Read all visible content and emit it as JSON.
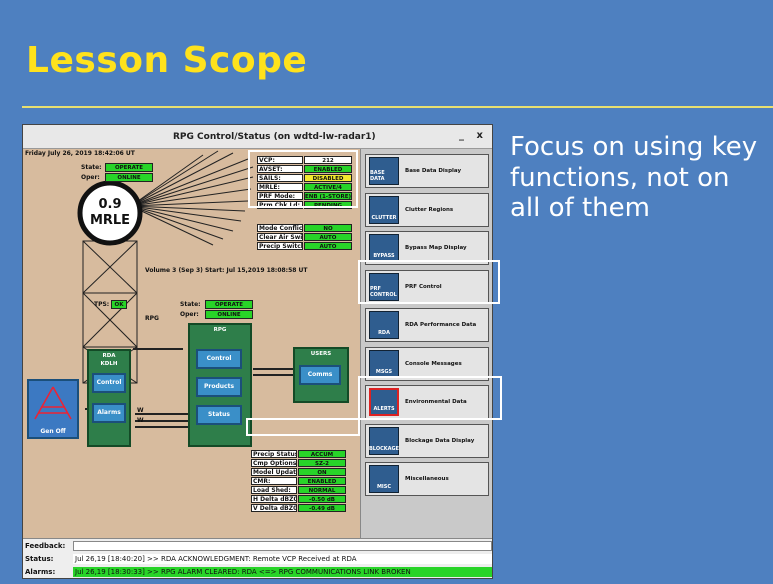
{
  "slide": {
    "title": "Lesson Scope",
    "bullet": "Focus on using key functions, not on all of them"
  },
  "window": {
    "title": "RPG Control/Status (on wdtd-lw-radar1)",
    "minimize": "_",
    "close": "x"
  },
  "main": {
    "date": "Friday July 26, 2019  18:42:06 UT",
    "rda": {
      "state_label": "State:",
      "state_value": "OPERATE",
      "oper_label": "Oper:",
      "oper_value": "ONLINE",
      "radome_line1": "0.9",
      "radome_line2": "MRLE",
      "tps_label": "TPS:",
      "tps_value": "OK",
      "unit_title": "RDA",
      "unit_sub": "KDLH",
      "control": "Control",
      "alarms": "Alarms"
    },
    "status_table": [
      {
        "label": "VCP:",
        "value": "212",
        "style": "white"
      },
      {
        "label": "AVSET:",
        "value": "ENABLED",
        "style": "green"
      },
      {
        "label": "SAILS:",
        "value": "DISABLED",
        "style": "yellow"
      },
      {
        "label": "MRLE:",
        "value": "ACTIVE/4",
        "style": "green"
      },
      {
        "label": "PRF Mode:",
        "value": "ENB (1-STORE)",
        "style": "green"
      },
      {
        "label": "Prm Chk Ld:",
        "value": "PENDING",
        "style": "green"
      }
    ],
    "mode_table": [
      {
        "label": "Mode Conflict:",
        "value": "NO"
      },
      {
        "label": "Clear Air Switch:",
        "value": "AUTO"
      },
      {
        "label": "Precip Switch:",
        "value": "AUTO"
      }
    ],
    "volume": "Volume 3 (Sep 3) Start: Jul 15,2019  18:08:58 UT",
    "rpg": {
      "state_label": "State:",
      "state_value": "OPERATE",
      "oper_label": "Oper:",
      "oper_value": "ONLINE",
      "link_label": "RPG",
      "unit_title": "RPG",
      "control": "Control",
      "products": "Products",
      "status": "Status"
    },
    "users": {
      "unit_title": "USERS",
      "comms": "Comms"
    },
    "gen": {
      "label": "Gen Off"
    },
    "link_labels": [
      "W",
      "W"
    ],
    "lower_table": [
      {
        "label": "Precip Status:",
        "value": "ACCUM"
      },
      {
        "label": "Cmp Options:",
        "value": "SZ-2"
      },
      {
        "label": "Model Update:",
        "value": "ON"
      },
      {
        "label": "CMR:",
        "value": "ENABLED"
      },
      {
        "label": "Load Shed:",
        "value": "NORMAL"
      },
      {
        "label": "H Delta dBZ0:",
        "value": "-0.50 dB"
      },
      {
        "label": "V Delta dBZ0:",
        "value": "-0.49 dB"
      }
    ]
  },
  "sidebar": {
    "items": [
      {
        "label": "Base Data Display",
        "icon": "base-data-icon",
        "icon_text": "BASE DATA"
      },
      {
        "label": "Clutter Regions",
        "icon": "clutter-icon",
        "icon_text": "CLUTTER"
      },
      {
        "label": "Bypass Map Display",
        "icon": "bypass-map-icon",
        "icon_text": "BYPASS"
      },
      {
        "label": "PRF Control",
        "icon": "prf-icon",
        "icon_text": "PRF CONTROL"
      },
      {
        "label": "RDA Performance Data",
        "icon": "rda-perf-icon",
        "icon_text": "RDA"
      },
      {
        "label": "Console Messages",
        "icon": "console-icon",
        "icon_text": "MSGS"
      },
      {
        "label": "Environmental Data",
        "icon": "environmental-icon",
        "icon_text": "ALERTS"
      },
      {
        "label": "Blockage Data Display",
        "icon": "blockage-icon",
        "icon_text": "BLOCKAGE"
      },
      {
        "label": "Miscellaneous",
        "icon": "misc-icon",
        "icon_text": "MISC"
      }
    ]
  },
  "bottom": {
    "feedback_label": "Feedback:",
    "feedback_value": "",
    "status_label": "Status:",
    "status_value": "Jul 26,19 [18:40:20] >> RDA ACKNOWLEDGMENT: Remote VCP Received at RDA",
    "alarms_label": "Alarms:",
    "alarms_value": "Jul 26,19 [18:30:33] >> RPG ALARM CLEARED: RDA <=> RPG COMMUNICATIONS LINK BROKEN"
  },
  "colors": {
    "slide_bg": "#4e80c0",
    "title": "#ffe21c",
    "status_green": "#28d428",
    "status_yellow": "#f4ea2e",
    "unit_green": "#2e7e4a"
  }
}
